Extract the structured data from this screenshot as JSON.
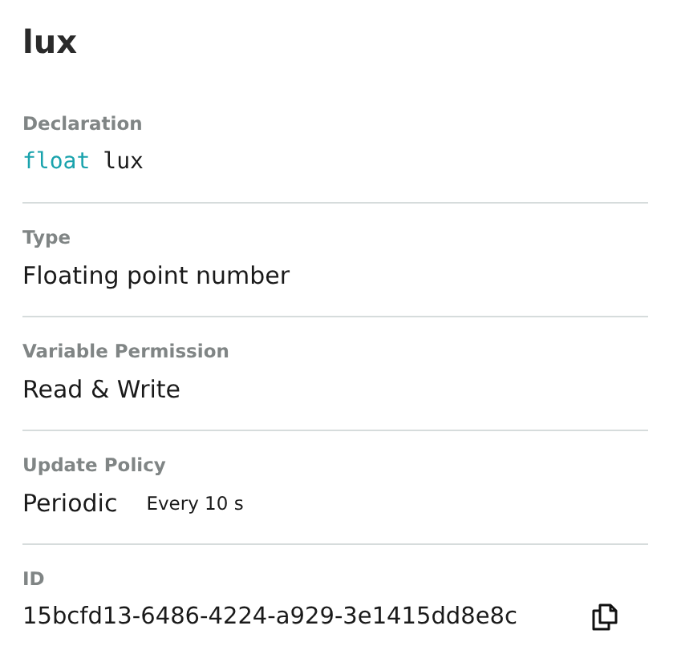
{
  "title": "lux",
  "sections": [
    {
      "kind": "code",
      "label": "Declaration",
      "keyword": "float",
      "value": "lux"
    },
    {
      "kind": "text",
      "label": "Type",
      "value": "Floating point number"
    },
    {
      "kind": "text",
      "label": "Variable Permission",
      "value": "Read & Write"
    },
    {
      "kind": "note",
      "label": "Update Policy",
      "value": "Periodic",
      "note": "Every 10 s"
    },
    {
      "kind": "copy",
      "label": "ID",
      "value": "15bcfd13-6486-4224-a929-3e1415dd8e8c"
    }
  ]
}
